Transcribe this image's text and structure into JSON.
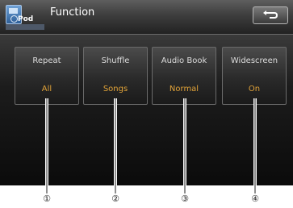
{
  "header": {
    "app_icon_label": "Pod",
    "title": "Function",
    "back_icon": "return-arrow-icon"
  },
  "function_buttons": [
    {
      "label": "Repeat",
      "value": "All"
    },
    {
      "label": "Shuffle",
      "value": "Songs"
    },
    {
      "label": "Audio Book",
      "value": "Normal"
    },
    {
      "label": "Widescreen",
      "value": "On"
    }
  ],
  "callouts": [
    "①",
    "②",
    "③",
    "④"
  ],
  "colors": {
    "value_text": "#e0a238",
    "label_text": "#dcdcdc",
    "title_text": "#ffffff"
  }
}
